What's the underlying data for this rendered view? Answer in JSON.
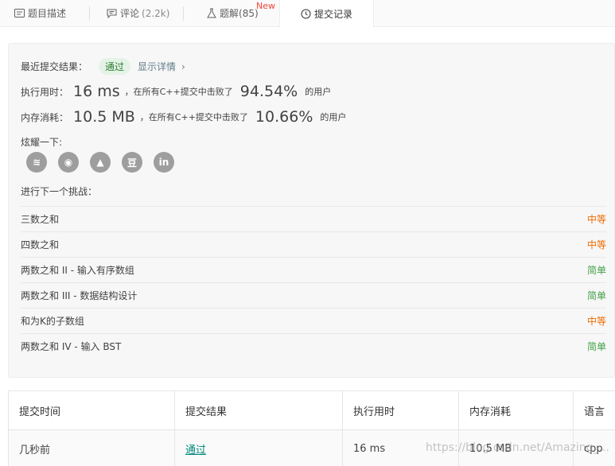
{
  "tabs": [
    {
      "label": "题目描述",
      "count": "",
      "icon": "description-icon",
      "active": false
    },
    {
      "label": "评论",
      "count": "(2.2k)",
      "icon": "comment-icon",
      "active": false
    },
    {
      "label": "题解",
      "count": "(85)",
      "icon": "flask-icon",
      "active": false,
      "badge": "New"
    },
    {
      "label": "提交记录",
      "count": "",
      "icon": "clock-icon",
      "active": true
    }
  ],
  "result": {
    "recent_label": "最近提交结果：",
    "status": "通过",
    "detail_link": "显示详情",
    "detail_arrow": "›",
    "runtime_label": "执行用时：",
    "runtime_value": "16 ms",
    "runtime_mid": "，在所有C++提交中击败了",
    "runtime_percent": "94.54%",
    "runtime_suffix": "的用户",
    "memory_label": "内存消耗：",
    "memory_value": "10.5 MB",
    "memory_mid": "，在所有C++提交中击败了",
    "memory_percent": "10.66%",
    "memory_suffix": "的用户",
    "share_label": "炫耀一下:",
    "share_icons": [
      "wechat-icon",
      "weibo-icon",
      "qq-icon",
      "douban-icon",
      "linkedin-icon"
    ],
    "share_glyphs": [
      "≋",
      "◉",
      "▲",
      "豆",
      "in"
    ],
    "next_label": "进行下一个挑战："
  },
  "challenges": [
    {
      "title": "三数之和",
      "difficulty": "中等",
      "level": "mid"
    },
    {
      "title": "四数之和",
      "difficulty": "中等",
      "level": "mid"
    },
    {
      "title": "两数之和 II - 输入有序数组",
      "difficulty": "简单",
      "level": "easy"
    },
    {
      "title": "两数之和 III - 数据结构设计",
      "difficulty": "简单",
      "level": "easy"
    },
    {
      "title": "和为K的子数组",
      "difficulty": "中等",
      "level": "mid"
    },
    {
      "title": "两数之和 IV - 输入 BST",
      "difficulty": "简单",
      "level": "easy"
    }
  ],
  "table": {
    "headers": [
      "提交时间",
      "提交结果",
      "执行用时",
      "内存消耗",
      "语言"
    ],
    "rows": [
      [
        "几秒前",
        "通过",
        "16 ms",
        "10.5 MB",
        "cpp"
      ]
    ]
  },
  "watermark": "https://blog.csdn.net/Amazing_...",
  "colors": {
    "pass": "#2e7d32",
    "medium": "#ef6c00",
    "easy": "#43a047",
    "link": "#607d8b"
  }
}
